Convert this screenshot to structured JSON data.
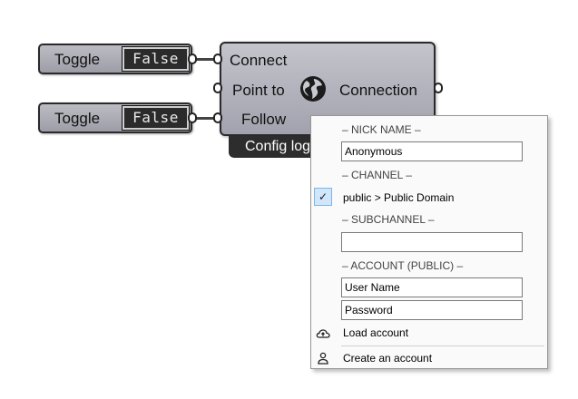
{
  "toggles": [
    {
      "label": "Toggle",
      "value": "False"
    },
    {
      "label": "Toggle",
      "value": "False"
    }
  ],
  "component": {
    "inputs": [
      "Connect",
      "Point to",
      "Follow"
    ],
    "output": "Connection",
    "caption": "Config login"
  },
  "menu": {
    "nick_header": "– NICK NAME –",
    "nick_value": "Anonymous",
    "channel_header": "– CHANNEL –",
    "channel_item": "public > Public Domain",
    "subchannel_header": "– SUBCHANNEL –",
    "subchannel_value": "",
    "account_header": "– ACCOUNT (PUBLIC) –",
    "username_value": "User Name",
    "password_value": "Password",
    "load_account": "Load account",
    "create_account": "Create an account"
  }
}
